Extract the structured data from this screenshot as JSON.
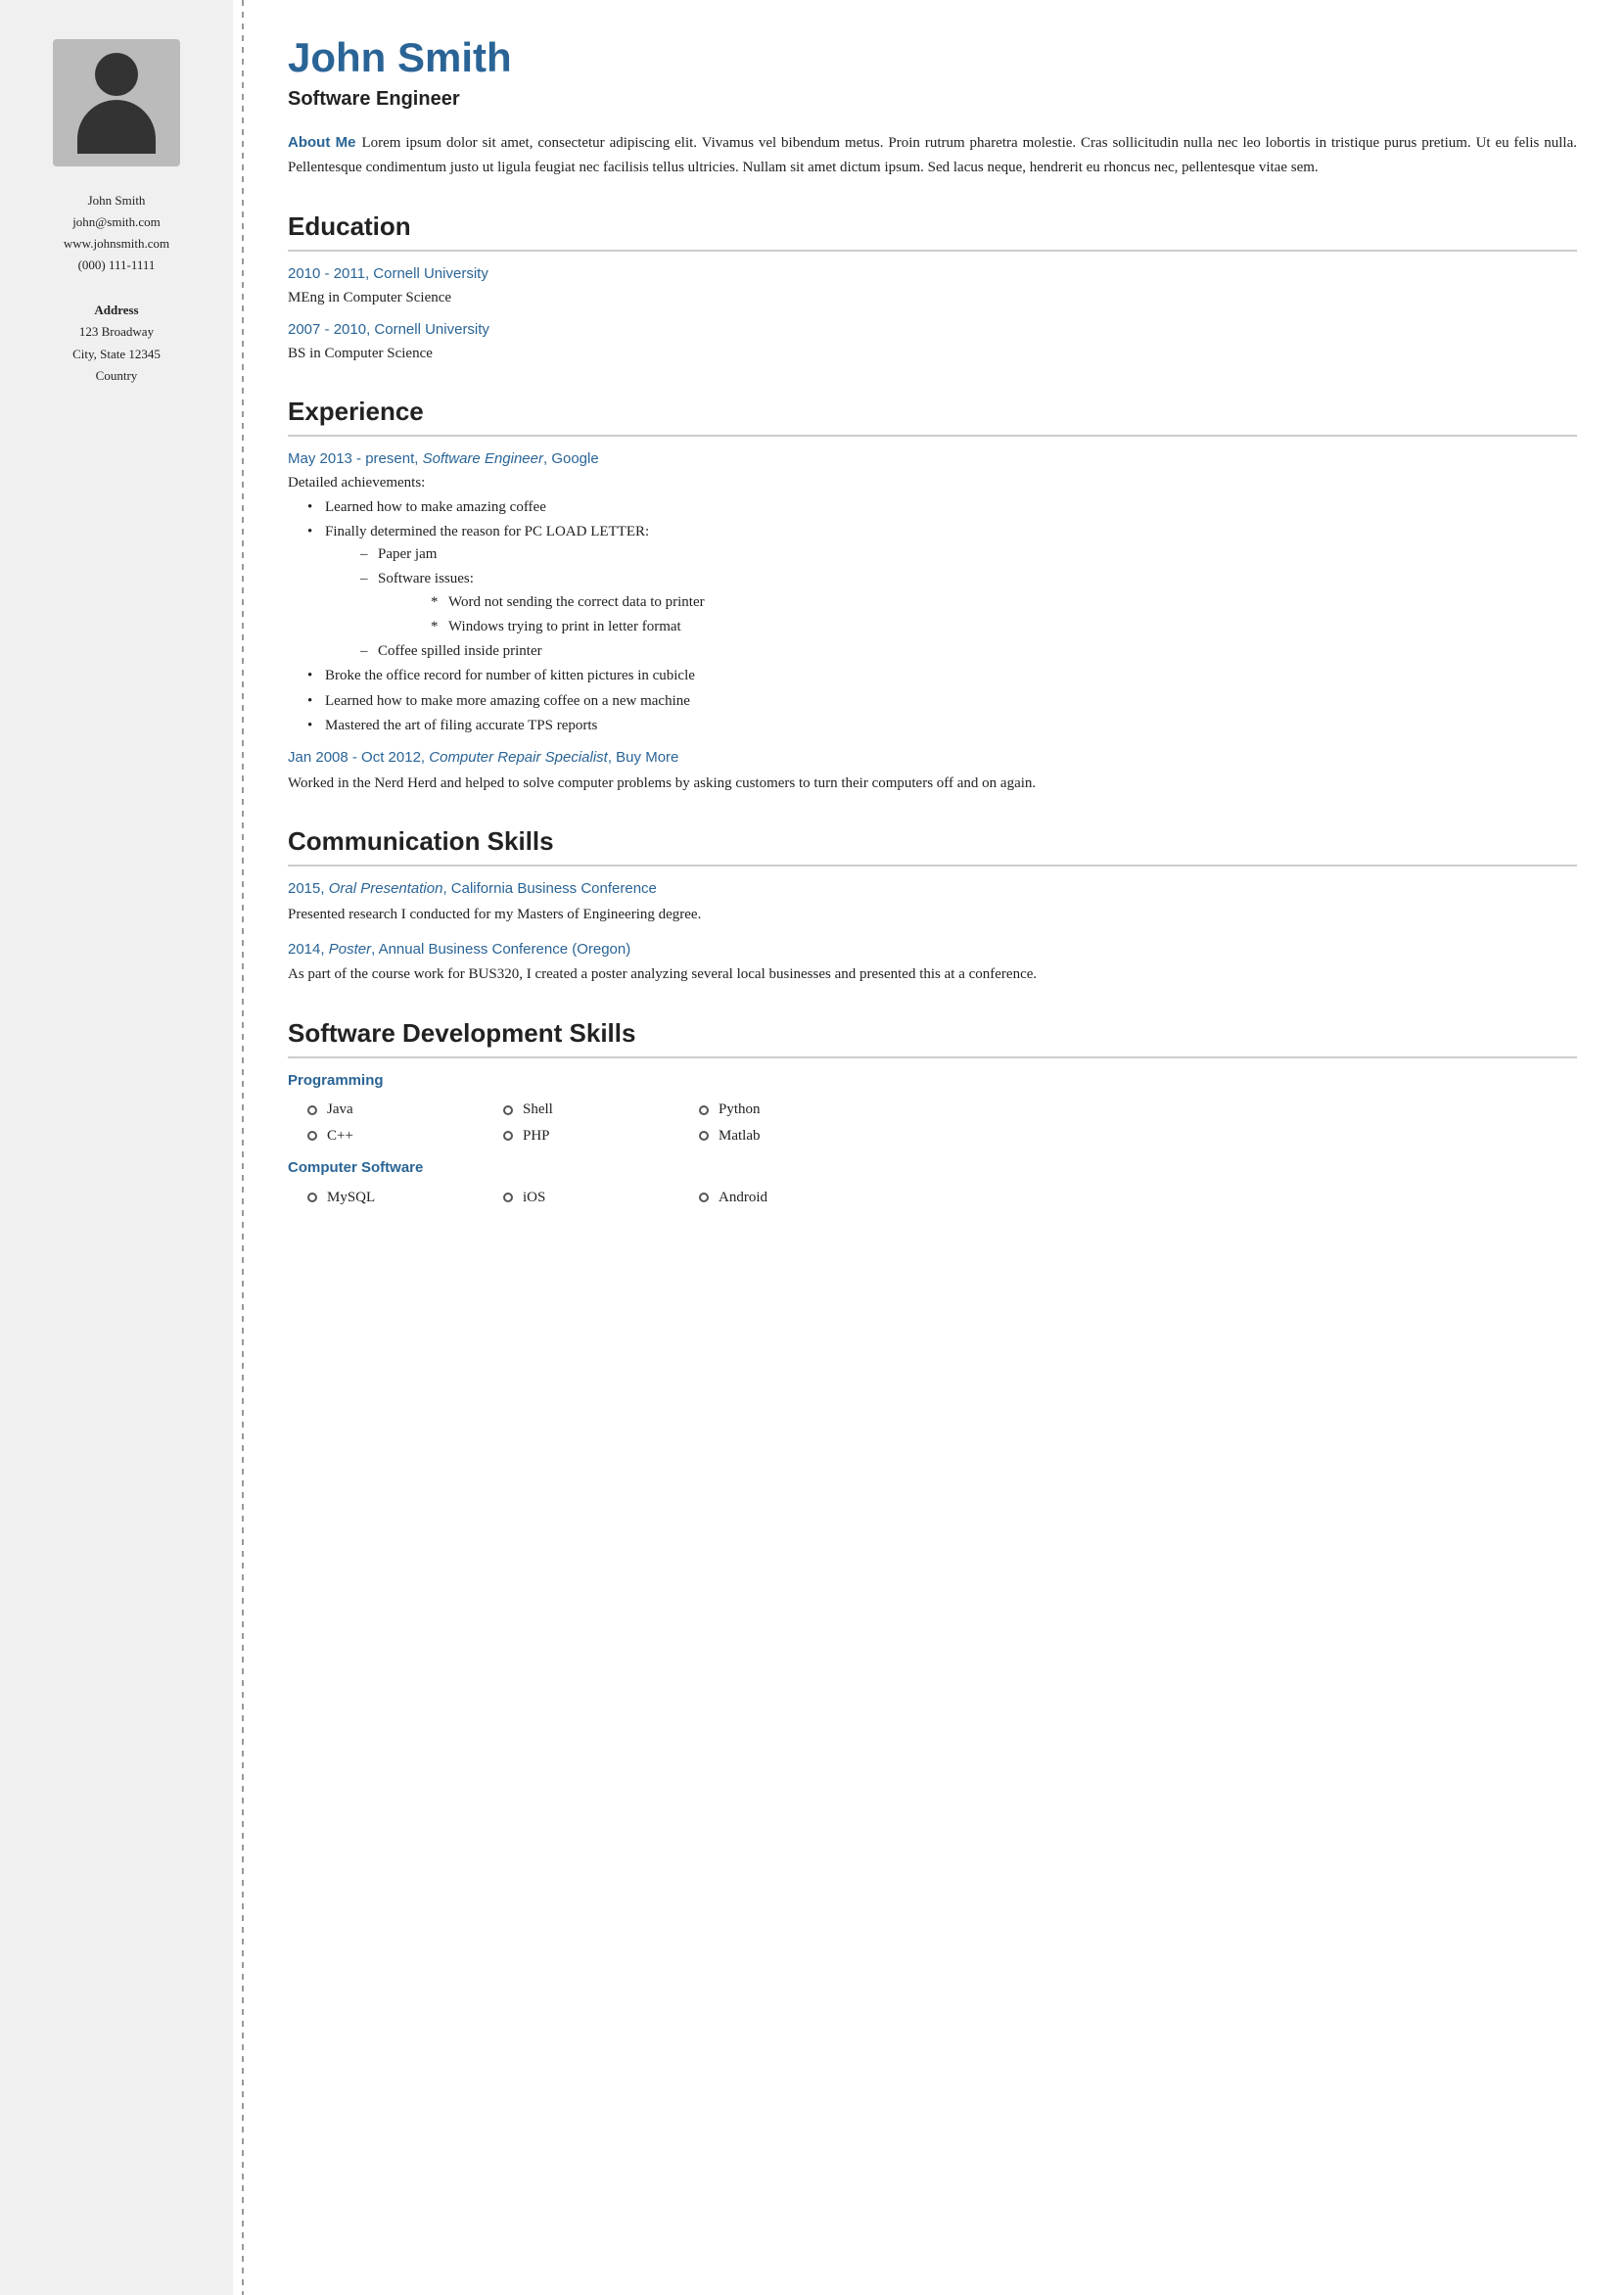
{
  "sidebar": {
    "name": "John Smith",
    "email": "john@smith.com",
    "website": "www.johnsmith.com",
    "phone": "(000) 111-1111",
    "address_label": "Address",
    "address_line1": "123 Broadway",
    "address_line2": "City, State 12345",
    "address_line3": "Country"
  },
  "main": {
    "name": "John Smith",
    "title": "Software Engineer",
    "about_me_label": "About Me",
    "about_me_text": "Lorem ipsum dolor sit amet, consectetur adipiscing elit. Vivamus vel bibendum metus. Proin rutrum pharetra molestie. Cras sollicitudin nulla nec leo lobortis in tristique purus pretium. Ut eu felis nulla. Pellentesque condimentum justo ut ligula feugiat nec facilisis tellus ultricies. Nullam sit amet dictum ipsum. Sed lacus neque, hendrerit eu rhoncus nec, pellentesque vitae sem.",
    "education_title": "Education",
    "education": [
      {
        "header": "2010 - 2011, Cornell University",
        "degree": "MEng in Computer Science"
      },
      {
        "header": "2007 - 2010, Cornell University",
        "degree": "BS in Computer Science"
      }
    ],
    "experience_title": "Experience",
    "experience": [
      {
        "header": "May 2013 - present, Software Engineer, Google",
        "header_italic_part": "Software Engineer",
        "achievements_label": "Detailed achievements:",
        "bullets": [
          "Learned how to make amazing coffee",
          "Finally determined the reason for PC LOAD LETTER:"
        ],
        "sub_bullets": [
          "Paper jam",
          "Software issues:"
        ],
        "star_bullets": [
          "Word not sending the correct data to printer",
          "Windows trying to print in letter format"
        ],
        "extra_dash": "Coffee spilled inside printer",
        "more_bullets": [
          "Broke the office record for number of kitten pictures in cubicle",
          "Learned how to make more amazing coffee on a new machine",
          "Mastered the art of filing accurate TPS reports"
        ]
      },
      {
        "header": "Jan 2008 - Oct 2012, Computer Repair Specialist, Buy More",
        "header_italic_part": "Computer Repair Specialist",
        "desc": "Worked in the Nerd Herd and helped to solve computer problems by asking customers to turn their computers off and on again."
      }
    ],
    "communication_title": "Communication Skills",
    "communication": [
      {
        "header": "2015, Oral Presentation, California Business Conference",
        "header_italic_part": "Oral Presentation",
        "desc": "Presented research I conducted for my Masters of Engineering degree."
      },
      {
        "header": "2014, Poster, Annual Business Conference (Oregon)",
        "header_italic_part": "Poster",
        "desc": "As part of the course work for BUS320, I created a poster analyzing several local businesses and presented this at a conference."
      }
    ],
    "skills_title": "Software Development Skills",
    "skills_categories": [
      {
        "label": "Programming",
        "items": [
          "Java",
          "Shell",
          "Python",
          "C++",
          "PHP",
          "Matlab"
        ]
      },
      {
        "label": "Computer Software",
        "items": [
          "MySQL",
          "iOS",
          "Android"
        ]
      }
    ]
  }
}
